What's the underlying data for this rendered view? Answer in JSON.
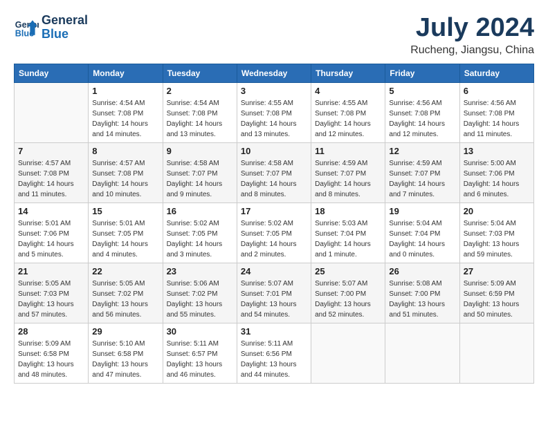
{
  "header": {
    "logo_line1": "General",
    "logo_line2": "Blue",
    "month": "July 2024",
    "location": "Rucheng, Jiangsu, China"
  },
  "columns": [
    "Sunday",
    "Monday",
    "Tuesday",
    "Wednesday",
    "Thursday",
    "Friday",
    "Saturday"
  ],
  "weeks": [
    [
      {
        "day": "",
        "info": ""
      },
      {
        "day": "1",
        "info": "Sunrise: 4:54 AM\nSunset: 7:08 PM\nDaylight: 14 hours\nand 14 minutes."
      },
      {
        "day": "2",
        "info": "Sunrise: 4:54 AM\nSunset: 7:08 PM\nDaylight: 14 hours\nand 13 minutes."
      },
      {
        "day": "3",
        "info": "Sunrise: 4:55 AM\nSunset: 7:08 PM\nDaylight: 14 hours\nand 13 minutes."
      },
      {
        "day": "4",
        "info": "Sunrise: 4:55 AM\nSunset: 7:08 PM\nDaylight: 14 hours\nand 12 minutes."
      },
      {
        "day": "5",
        "info": "Sunrise: 4:56 AM\nSunset: 7:08 PM\nDaylight: 14 hours\nand 12 minutes."
      },
      {
        "day": "6",
        "info": "Sunrise: 4:56 AM\nSunset: 7:08 PM\nDaylight: 14 hours\nand 11 minutes."
      }
    ],
    [
      {
        "day": "7",
        "info": "Sunrise: 4:57 AM\nSunset: 7:08 PM\nDaylight: 14 hours\nand 11 minutes."
      },
      {
        "day": "8",
        "info": "Sunrise: 4:57 AM\nSunset: 7:08 PM\nDaylight: 14 hours\nand 10 minutes."
      },
      {
        "day": "9",
        "info": "Sunrise: 4:58 AM\nSunset: 7:07 PM\nDaylight: 14 hours\nand 9 minutes."
      },
      {
        "day": "10",
        "info": "Sunrise: 4:58 AM\nSunset: 7:07 PM\nDaylight: 14 hours\nand 8 minutes."
      },
      {
        "day": "11",
        "info": "Sunrise: 4:59 AM\nSunset: 7:07 PM\nDaylight: 14 hours\nand 8 minutes."
      },
      {
        "day": "12",
        "info": "Sunrise: 4:59 AM\nSunset: 7:07 PM\nDaylight: 14 hours\nand 7 minutes."
      },
      {
        "day": "13",
        "info": "Sunrise: 5:00 AM\nSunset: 7:06 PM\nDaylight: 14 hours\nand 6 minutes."
      }
    ],
    [
      {
        "day": "14",
        "info": "Sunrise: 5:01 AM\nSunset: 7:06 PM\nDaylight: 14 hours\nand 5 minutes."
      },
      {
        "day": "15",
        "info": "Sunrise: 5:01 AM\nSunset: 7:05 PM\nDaylight: 14 hours\nand 4 minutes."
      },
      {
        "day": "16",
        "info": "Sunrise: 5:02 AM\nSunset: 7:05 PM\nDaylight: 14 hours\nand 3 minutes."
      },
      {
        "day": "17",
        "info": "Sunrise: 5:02 AM\nSunset: 7:05 PM\nDaylight: 14 hours\nand 2 minutes."
      },
      {
        "day": "18",
        "info": "Sunrise: 5:03 AM\nSunset: 7:04 PM\nDaylight: 14 hours\nand 1 minute."
      },
      {
        "day": "19",
        "info": "Sunrise: 5:04 AM\nSunset: 7:04 PM\nDaylight: 14 hours\nand 0 minutes."
      },
      {
        "day": "20",
        "info": "Sunrise: 5:04 AM\nSunset: 7:03 PM\nDaylight: 13 hours\nand 59 minutes."
      }
    ],
    [
      {
        "day": "21",
        "info": "Sunrise: 5:05 AM\nSunset: 7:03 PM\nDaylight: 13 hours\nand 57 minutes."
      },
      {
        "day": "22",
        "info": "Sunrise: 5:05 AM\nSunset: 7:02 PM\nDaylight: 13 hours\nand 56 minutes."
      },
      {
        "day": "23",
        "info": "Sunrise: 5:06 AM\nSunset: 7:02 PM\nDaylight: 13 hours\nand 55 minutes."
      },
      {
        "day": "24",
        "info": "Sunrise: 5:07 AM\nSunset: 7:01 PM\nDaylight: 13 hours\nand 54 minutes."
      },
      {
        "day": "25",
        "info": "Sunrise: 5:07 AM\nSunset: 7:00 PM\nDaylight: 13 hours\nand 52 minutes."
      },
      {
        "day": "26",
        "info": "Sunrise: 5:08 AM\nSunset: 7:00 PM\nDaylight: 13 hours\nand 51 minutes."
      },
      {
        "day": "27",
        "info": "Sunrise: 5:09 AM\nSunset: 6:59 PM\nDaylight: 13 hours\nand 50 minutes."
      }
    ],
    [
      {
        "day": "28",
        "info": "Sunrise: 5:09 AM\nSunset: 6:58 PM\nDaylight: 13 hours\nand 48 minutes."
      },
      {
        "day": "29",
        "info": "Sunrise: 5:10 AM\nSunset: 6:58 PM\nDaylight: 13 hours\nand 47 minutes."
      },
      {
        "day": "30",
        "info": "Sunrise: 5:11 AM\nSunset: 6:57 PM\nDaylight: 13 hours\nand 46 minutes."
      },
      {
        "day": "31",
        "info": "Sunrise: 5:11 AM\nSunset: 6:56 PM\nDaylight: 13 hours\nand 44 minutes."
      },
      {
        "day": "",
        "info": ""
      },
      {
        "day": "",
        "info": ""
      },
      {
        "day": "",
        "info": ""
      }
    ]
  ]
}
